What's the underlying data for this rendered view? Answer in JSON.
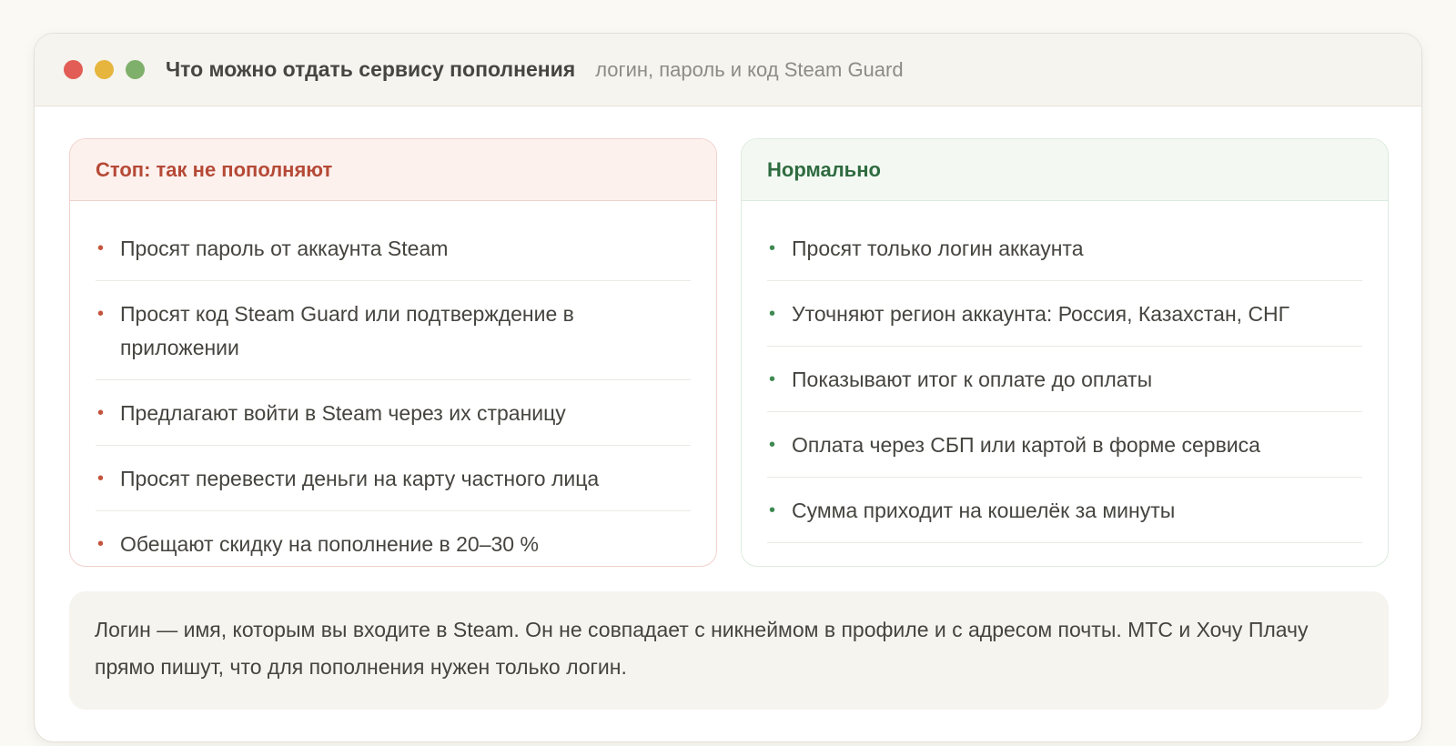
{
  "window": {
    "title": "Что можно отдать сервису пополнения",
    "subtitle": "логин, пароль и код Steam Guard"
  },
  "bad_card": {
    "heading": "Стоп: так не пополняют",
    "items": [
      "Просят пароль от аккаунта Steam",
      "Просят код Steam Guard или подтверждение в приложении",
      "Предлагают войти в Steam через их страницу",
      "Просят перевести деньги на карту частного лица",
      "Обещают скидку на пополнение в 20–30 %"
    ]
  },
  "good_card": {
    "heading": "Нормально",
    "items": [
      "Просят только логин аккаунта",
      "Уточняют регион аккаунта: Россия, Казахстан, СНГ",
      "Показывают итог к оплате до оплаты",
      "Оплата через СБП или картой в форме сервиса",
      "Сумма приходит на кошелёк за минуты"
    ]
  },
  "note": "Логин — имя, которым вы входите в Steam. Он не совпадает с никнеймом в профиле и с адресом почты. МТС и Хочу Плачу прямо пишут, что для пополнения нужен только логин.",
  "colors": {
    "close": "#e25d55",
    "minimize": "#e6b53d",
    "maximize": "#7fb06b",
    "bad_accent": "#b54a36",
    "good_accent": "#2f6b40"
  }
}
